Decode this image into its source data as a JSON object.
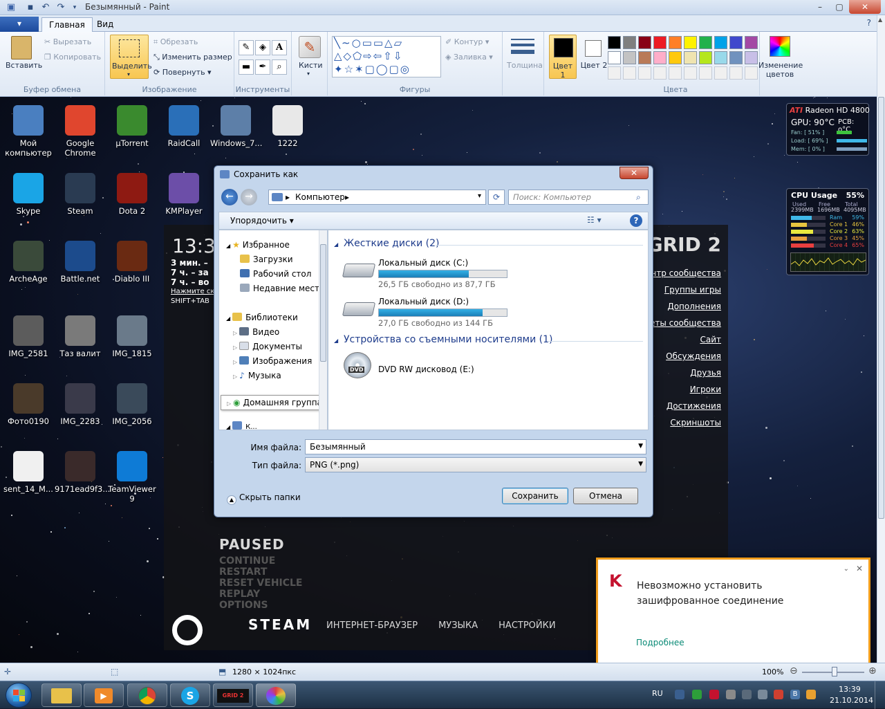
{
  "window": {
    "title": "Безымянный - Paint"
  },
  "ribbon": {
    "file_tab": "▾",
    "tabs": [
      "Главная",
      "Вид"
    ],
    "clipboard": {
      "paste": "Вставить",
      "cut": "Вырезать",
      "copy": "Копировать",
      "group": "Буфер обмена"
    },
    "image": {
      "select": "Выделить",
      "crop": "Обрезать",
      "resize": "Изменить размер",
      "rotate": "Повернуть",
      "group": "Изображение"
    },
    "tools": {
      "group": "Инструменты"
    },
    "brushes": {
      "label": "Кисти"
    },
    "shapes": {
      "outline": "Контур",
      "fill": "Заливка",
      "group": "Фигуры"
    },
    "size": {
      "label": "Толщина"
    },
    "colors": {
      "color1": "Цвет 1",
      "color2": "Цвет 2",
      "edit": "Изменение цветов",
      "group": "Цвета",
      "palette_row1": [
        "#000000",
        "#7f7f7f",
        "#880015",
        "#ed1c24",
        "#ff7f27",
        "#fff200",
        "#22b14c",
        "#00a2e8",
        "#3f48cc",
        "#a349a4"
      ],
      "palette_row2": [
        "#ffffff",
        "#c3c3c3",
        "#b97a57",
        "#ffaec9",
        "#ffc90e",
        "#efe4b0",
        "#b5e61d",
        "#99d9ea",
        "#7092be",
        "#c8bfe7"
      ]
    }
  },
  "desktop": {
    "icons": [
      {
        "label": "Мой компьютер",
        "color": "#4a7fc0"
      },
      {
        "label": "Google Chrome",
        "color": "#e0462e"
      },
      {
        "label": "µTorrent",
        "color": "#3a8a2e"
      },
      {
        "label": "RaidCall",
        "color": "#2a6fb8"
      },
      {
        "label": "Windows_7...",
        "color": "#5d7fa8"
      },
      {
        "label": "1222",
        "color": "#e8e8e8"
      },
      {
        "label": "Skype",
        "color": "#1aa5e6"
      },
      {
        "label": "Steam",
        "color": "#2a3b52"
      },
      {
        "label": "Dota 2",
        "color": "#8e1a12"
      },
      {
        "label": "KMPlayer",
        "color": "#6c4ea8"
      },
      {
        "label": "ArcheAge",
        "color": "#3a4a3a"
      },
      {
        "label": "Battle.net",
        "color": "#1c4b8c"
      },
      {
        "label": "Diablo III",
        "color": "#6a2a12"
      },
      {
        "label": "IMG_2581",
        "color": "#5c5c5c"
      },
      {
        "label": "Таз валит",
        "color": "#7a7a7a"
      },
      {
        "label": "IMG_1815",
        "color": "#6a7a8a"
      },
      {
        "label": "Фото0190",
        "color": "#4a3a2a"
      },
      {
        "label": "IMG_2283",
        "color": "#3a3a4a"
      },
      {
        "label": "IMG_2056",
        "color": "#3a4a5a"
      },
      {
        "label": "sent_14_M...",
        "color": "#f0f0f0"
      },
      {
        "label": "9171ead9f3...",
        "color": "#3a2a2a"
      },
      {
        "label": "TeamViewer 9",
        "color": "#0e7bd6"
      }
    ]
  },
  "steam": {
    "time": "13:3",
    "lines": [
      "3 мин. –",
      "7 ч. – за",
      "7 ч. – во",
      "Нажмите ск",
      "SHIFT+TAB"
    ],
    "game_title": "GRID 2",
    "links": [
      "ентр сообщества",
      "Группы игры",
      "Дополнения",
      "веты сообщества",
      "Сайт",
      "Обсуждения",
      "Друзья",
      "Игроки",
      "Достижения",
      "Скриншоты"
    ],
    "paused": "PAUSED",
    "menu": [
      "CONTINUE",
      "RESTART",
      "RESET VEHICLE",
      "REPLAY",
      "OPTIONS"
    ],
    "logo": "STEAM",
    "bottom_links": [
      "ИНТЕРНЕТ-БРАУЗЕР",
      "МУЗЫКА",
      "НАСТРОЙКИ"
    ]
  },
  "dialog": {
    "title": "Сохранить как",
    "address": "Компьютер",
    "search_placeholder": "Поиск: Компьютер",
    "organize": "Упорядочить",
    "nav": {
      "favorites": "Избранное",
      "downloads": "Загрузки",
      "desktop": "Рабочий стол",
      "recent": "Недавние места",
      "libraries": "Библиотеки",
      "video": "Видео",
      "documents": "Документы",
      "images": "Изображения",
      "music": "Музыка",
      "homegroup": "Домашняя группа",
      "computer": "К..."
    },
    "hard_disks_header": "Жесткие диски (2)",
    "drives": [
      {
        "name": "Локальный диск (C:)",
        "free": "26,5 ГБ свободно из 87,7 ГБ",
        "used_fraction": 0.7
      },
      {
        "name": "Локальный диск (D:)",
        "free": "27,0 ГБ свободно из 144 ГБ",
        "used_fraction": 0.81
      }
    ],
    "removable_header": "Устройства со съемными носителями (1)",
    "dvd": {
      "name": "DVD RW дисковод (E:)",
      "badge": "DVD"
    },
    "filename_label": "Имя файла:",
    "filename_value": "Безымянный",
    "filetype_label": "Тип файла:",
    "filetype_value": "PNG (*.png)",
    "hide_folders": "Скрыть папки",
    "save": "Сохранить",
    "cancel": "Отмена"
  },
  "gadgets": {
    "gpu": {
      "brand": "ATI",
      "model": "Radeon HD 4800",
      "gpu_temp": "GPU: 90°C",
      "pcb": "PCB: o°C",
      "fan": "Fan: [ 51% ]",
      "load": "Load: [ 69% ]",
      "mem": "Mem: [ 0% ]"
    },
    "cpu": {
      "title": "CPU Usage",
      "total": "55%",
      "headers": [
        "Used",
        "Free",
        "Total"
      ],
      "values": [
        "2399MB",
        "1696MB",
        "4095MB"
      ],
      "rows": [
        {
          "label": "Ram",
          "value": "59%",
          "level": 0.59,
          "color": "#3fb8e8"
        },
        {
          "label": "Core 1",
          "value": "46%",
          "level": 0.46,
          "color": "#e8c53f"
        },
        {
          "label": "Core 2",
          "value": "63%",
          "level": 0.63,
          "color": "#e8e83f"
        },
        {
          "label": "Core 3",
          "value": "45%",
          "level": 0.45,
          "color": "#e8a03f"
        },
        {
          "label": "Core 4",
          "value": "65%",
          "level": 0.65,
          "color": "#e83f3f"
        }
      ]
    }
  },
  "notification": {
    "line1": "Невозможно установить",
    "line2": "зашифрованное соединение",
    "link": "Подробнее"
  },
  "statusbar": {
    "size": "1280 × 1024пкс",
    "zoom": "100%"
  },
  "taskbar": {
    "lang": "RU",
    "time": "13:39",
    "date": "21.10.2014",
    "grid_label": "GRID 2"
  }
}
